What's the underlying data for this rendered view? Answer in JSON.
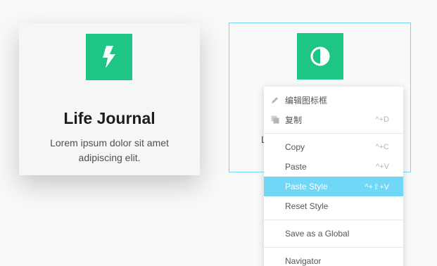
{
  "card1": {
    "icon": "bolt-icon",
    "title": "Life Journal",
    "desc_line1": "Lorem ipsum dolor sit amet",
    "desc_line2": "adipiscing elit."
  },
  "card2": {
    "icon": "contrast-icon",
    "peek_text": "L"
  },
  "menu": {
    "items": [
      {
        "label": "编辑图标框",
        "shortcut": "",
        "icon": "pencil-icon"
      },
      {
        "label": "复制",
        "shortcut": "^+D",
        "icon": "copy-icon"
      },
      {
        "label": "Copy",
        "shortcut": "^+C"
      },
      {
        "label": "Paste",
        "shortcut": "^+V"
      },
      {
        "label": "Paste Style",
        "shortcut": "^+⇧+V"
      },
      {
        "label": "Reset Style",
        "shortcut": ""
      },
      {
        "label": "Save as a Global",
        "shortcut": ""
      },
      {
        "label": "Navigator",
        "shortcut": ""
      }
    ]
  },
  "colors": {
    "accent_green": "#1ec584",
    "highlight_blue": "#71d7f7"
  }
}
